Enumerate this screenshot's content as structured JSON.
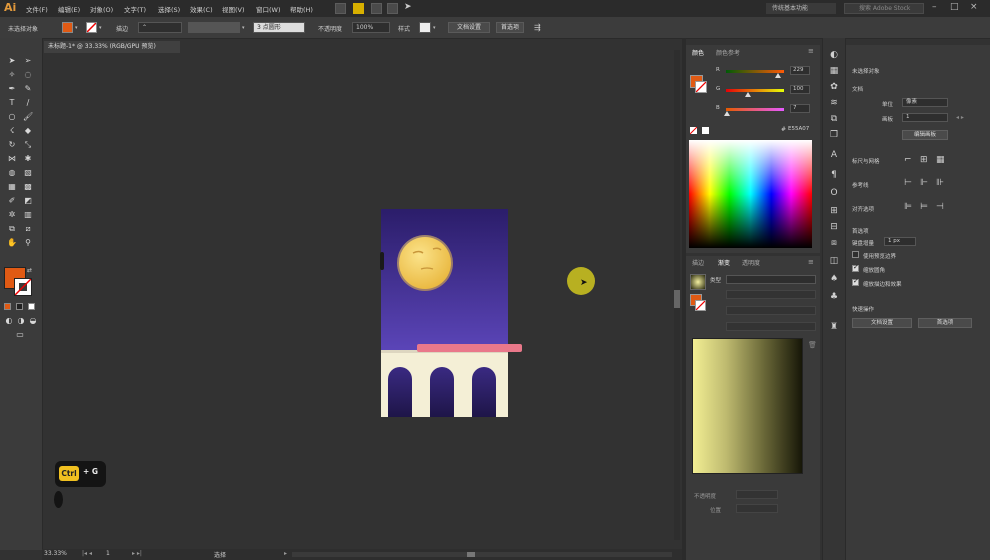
{
  "app": {
    "logo": "Ai"
  },
  "menu": {
    "items": [
      "文件(F)",
      "编辑(E)",
      "对象(O)",
      "文字(T)",
      "选择(S)",
      "效果(C)",
      "视图(V)",
      "窗口(W)",
      "帮助(H)"
    ],
    "workspace": "传统基本功能",
    "search_placeholder": "搜索 Adobe Stock"
  },
  "controlbar": {
    "selection_label": "未选择对象",
    "stroke_label": "描边",
    "profile_value": "3 点圆形",
    "opacity_label": "不透明度",
    "opacity_value": "100%",
    "style_label": "样式",
    "doc_setup": "文档设置",
    "preferences": "首选项"
  },
  "document": {
    "tab_title": "未标题-1* @ 33.33% (RGB/GPU 预览)"
  },
  "colors": {
    "fill": "#e05a14",
    "accent_yellow": "#f0c020"
  },
  "color_panel": {
    "tabs": [
      "颜色",
      "颜色参考"
    ],
    "r_label": "R",
    "r_value": "229",
    "g_label": "G",
    "g_value": "100",
    "b_label": "B",
    "b_value": "7",
    "hex": "E55A07"
  },
  "gradient_panel": {
    "tabs": [
      "描边",
      "渐变",
      "透明度"
    ],
    "type_label": "类型",
    "bottom_labels": [
      "不透明度",
      "位置"
    ]
  },
  "properties": {
    "header": "未选择对象",
    "doc_section": "文档",
    "unit_label": "单位",
    "unit_value": "像素",
    "artboard_label": "画板",
    "artboard_value": "1",
    "edit_artboard": "编辑画板",
    "rulers_label": "标尺与网格",
    "guides_label": "参考线",
    "align_label": "对齐选项",
    "prefs_section": "首选项",
    "key_increment_label": "键盘增量",
    "key_increment_value": "1 px",
    "checkbox1": "使用预览边界",
    "checkbox2": "缩放圆角",
    "checkbox3": "缩放描边和效果",
    "quick_actions": "快速操作",
    "doc_setup_btn": "文档设置",
    "prefs_btn": "首选项"
  },
  "statusbar": {
    "zoom": "33.33%",
    "artboard_num": "1",
    "tool": "选择"
  },
  "keyboard_hint": {
    "key1": "Ctrl",
    "key2": "+ G"
  }
}
